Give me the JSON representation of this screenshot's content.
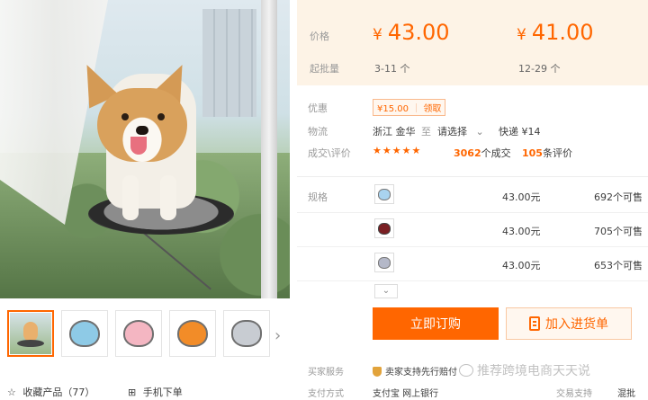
{
  "product": {
    "thumbnails": [
      {
        "name": "thumb-dog-photo",
        "color": ""
      },
      {
        "name": "thumb-blue",
        "color": "#8ecae6"
      },
      {
        "name": "thumb-pink",
        "color": "#f4b6c2"
      },
      {
        "name": "thumb-orange",
        "color": "#f28c28"
      },
      {
        "name": "thumb-grey",
        "color": "#c8ccd2"
      }
    ],
    "favorite_label": "收藏产品（77）",
    "mobile_order_label": "手机下单"
  },
  "pricing": {
    "price_label": "价格",
    "moq_label": "起批量",
    "tiers": [
      {
        "currency": "¥",
        "price": "43.00",
        "range": "3-11 个"
      },
      {
        "currency": "¥",
        "price": "41.00",
        "range": "12-29 个"
      }
    ]
  },
  "info": {
    "promo_label": "优惠",
    "coupon_amount": "¥15.00",
    "coupon_action": "领取",
    "logistics_label": "物流",
    "origin": "浙江 金华",
    "to": "至",
    "destination": "请选择",
    "shipping": "快递 ¥14",
    "reviews_label": "成交\\评价",
    "stars": "★★★★★",
    "deals_count": "3062",
    "deals_suffix": "个成交",
    "reviews_count": "105",
    "reviews_suffix": "条评价"
  },
  "sku": {
    "label": "规格",
    "rows": [
      {
        "color": "#a9d3ef",
        "price": "43.00元",
        "stock": "692个可售"
      },
      {
        "color": "#7a1f23",
        "price": "43.00元",
        "stock": "705个可售"
      },
      {
        "color": "#b4b8c8",
        "price": "43.00元",
        "stock": "653个可售"
      }
    ],
    "expand_glyph": "⌄"
  },
  "actions": {
    "buy_label": "立即订购",
    "cart_label": "加入进货单"
  },
  "service": {
    "seller_service_label": "买家服务",
    "seller_service_text": "卖家支持先行赔付",
    "payment_label": "支付方式",
    "payment_methods": "支付宝  网上银行",
    "trade_label": "交易支持",
    "trade_value": "混批"
  },
  "watermark": "推荐跨境电商天天说",
  "colors": {
    "accent": "#ff6600",
    "price_bg": "#fdf3e6"
  }
}
